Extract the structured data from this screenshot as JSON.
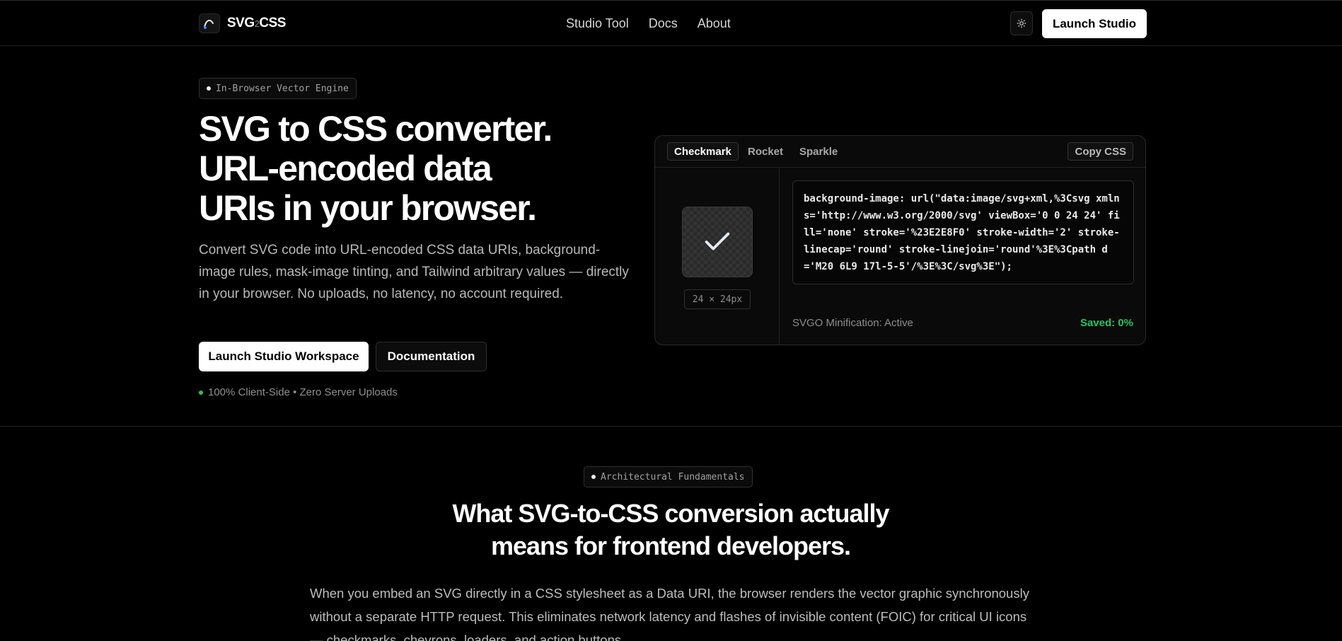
{
  "header": {
    "logo": {
      "main": "SVG",
      "two": "2",
      "tail": "CSS"
    },
    "nav": [
      "Studio Tool",
      "Docs",
      "About"
    ],
    "launch_label": "Launch Studio"
  },
  "hero": {
    "badge": "In-Browser Vector Engine",
    "title_lines": [
      "SVG to CSS converter.",
      "URL-encoded data",
      "URIs in your browser."
    ],
    "description": "Convert SVG code into URL-encoded CSS data URIs, background-image rules, mask-image tinting, and Tailwind arbitrary values — directly in your browser. No uploads, no latency, no account required.",
    "primary_button": "Launch Studio Workspace",
    "secondary_button": "Documentation",
    "trust_text": "100% Client-Side • Zero Server Uploads"
  },
  "demo": {
    "tabs": [
      "Checkmark",
      "Rocket",
      "Sparkle"
    ],
    "active_tab": "Checkmark",
    "copy_label": "Copy CSS",
    "size_label": "24 × 24px",
    "code": "background-image: url(\"data:image/svg+xml,%3Csvg xmlns='http://www.w3.org/2000/svg' viewBox='0 0 24 24' fill='none' stroke='%23E2E8F0' stroke-width='2' stroke-linecap='round' stroke-linejoin='round'%3E%3Cpath d='M20 6L9 17l-5-5'/%3E%3C/svg%3E\");",
    "svgo_status": "SVGO Minification: Active",
    "saved": "Saved: 0%",
    "accent_color": "#22c55e"
  },
  "section": {
    "badge": "Architectural Fundamentals",
    "title_lines": [
      "What SVG-to-CSS conversion actually",
      "means for frontend developers."
    ],
    "body": "When you embed an SVG directly in a CSS stylesheet as a Data URI, the browser renders the vector graphic synchronously without a separate HTTP request. This eliminates network latency and flashes of invisible content (FOIC) for critical UI icons — checkmarks, chevrons, loaders, and action buttons."
  }
}
